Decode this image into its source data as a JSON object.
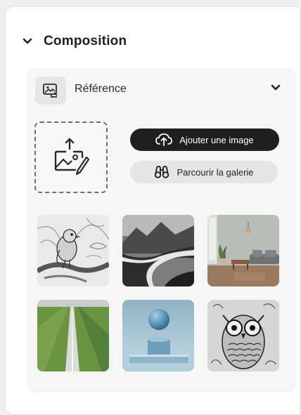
{
  "composition": {
    "title": "Composition",
    "reference": {
      "label": "Référence",
      "upload_button_label": "Ajouter une image",
      "browse_button_label": "Parcourir la galerie",
      "icons": {
        "collapse": "chevron-down-icon",
        "reference": "image-reference-icon",
        "upload": "upload-image-icon",
        "add": "cloud-upload-icon",
        "browse": "binoculars-icon"
      },
      "gallery": [
        {
          "subject": "sketch-bird-on-branch",
          "style": "grayscale pencil sketch"
        },
        {
          "subject": "mountain-river-valley",
          "style": "monochrome landscape"
        },
        {
          "subject": "modern-living-room",
          "style": "photo interior"
        },
        {
          "subject": "green-field-road",
          "style": "aerial photo"
        },
        {
          "subject": "sphere-on-pedestal",
          "style": "3d render blue"
        },
        {
          "subject": "owl-engraving",
          "style": "black and white etching"
        }
      ]
    }
  },
  "colors": {
    "panel_bg": "#ffffff",
    "card_bg": "#f6f6f6",
    "primary_button_bg": "#1f1f1f",
    "secondary_button_bg": "#e5e5e5",
    "text": "#1f1f1f"
  }
}
